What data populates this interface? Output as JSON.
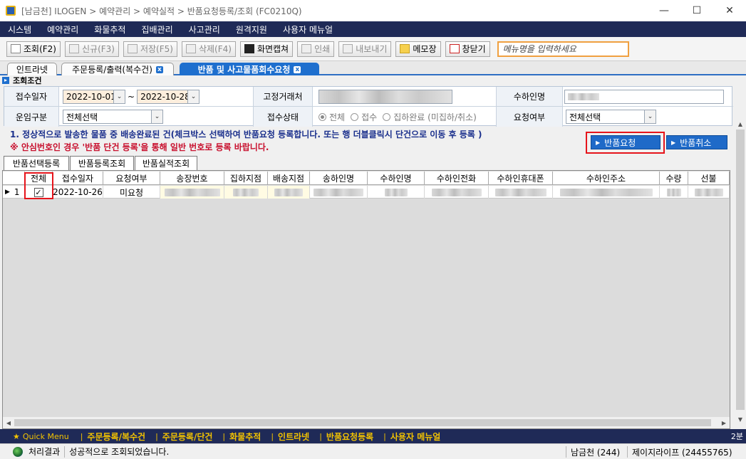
{
  "window": {
    "title": "[남금천] ILOGEN > 예약관리 > 예약실적 > 반품요청등록/조회 (FC0210Q)",
    "minimize_glyph": "—",
    "maximize_glyph": "☐",
    "close_glyph": "✕"
  },
  "menubar": [
    "시스템",
    "예약관리",
    "화물추적",
    "집배관리",
    "사고관리",
    "원격지원",
    "사용자 메뉴얼"
  ],
  "toolbar": {
    "buttons": [
      {
        "label": "조회(F2)",
        "icon": "search-doc-icon",
        "enabled": true
      },
      {
        "label": "신규(F3)",
        "icon": "new-doc-icon",
        "enabled": false
      },
      {
        "label": "저장(F5)",
        "icon": "save-icon",
        "enabled": false
      },
      {
        "label": "삭제(F4)",
        "icon": "delete-icon",
        "enabled": false
      },
      {
        "label": "화면캡쳐",
        "icon": "camera-icon",
        "enabled": true
      },
      {
        "label": "인쇄",
        "icon": "print-icon",
        "enabled": false
      },
      {
        "label": "내보내기",
        "icon": "export-icon",
        "enabled": false
      },
      {
        "label": "메모장",
        "icon": "memo-icon",
        "enabled": true
      },
      {
        "label": "창닫기",
        "icon": "close-window-icon",
        "enabled": true
      }
    ],
    "menu_search_placeholder": "메뉴명을 입력하세요"
  },
  "doc_tabs": [
    {
      "label": "인트라넷",
      "active": false,
      "closable": false
    },
    {
      "label": "주문등록/출력(복수건)",
      "active": false,
      "closable": true
    },
    {
      "label": "반품 및 사고물품회수요청",
      "active": true,
      "closable": true
    }
  ],
  "conditions": {
    "header": "조회조건",
    "receipt_date_label": "접수일자",
    "date_from": "2022-10-01",
    "date_tilde": "~",
    "date_to": "2022-10-28",
    "fixed_client_label": "고정거래처",
    "receiver_name_label": "수하인명",
    "fare_type_label": "운임구분",
    "fare_type_value": "전체선택",
    "receipt_status_label": "접수상태",
    "receipt_status_options": [
      "전체",
      "접수",
      "집하완료 (미집하/취소)"
    ],
    "receipt_status_selected": "전체",
    "request_label": "요청여부",
    "request_value": "전체선택",
    "dropdown_glyph": "⌄"
  },
  "notices": {
    "line1": "1. 정상적으로 발송한 물품 중 배송완료된 건(체크박스 선택하여 반품요청 등록합니다. 또는 행 더블클릭시 단건으로 이동 후 등록 )",
    "line2": "※ 안심번호인 경우 '반품 단건 등록'을 통해 일반 번호로 등록 바랍니다."
  },
  "actions": {
    "return_request": "반품요청",
    "return_cancel": "반품취소",
    "arrow_glyph": "▶"
  },
  "sub_tabs": [
    "반품선택등록",
    "반품등록조회",
    "반품실적조회"
  ],
  "grid": {
    "columns": [
      "전체",
      "접수일자",
      "요청여부",
      "송장번호",
      "집하지점",
      "배송지점",
      "송하인명",
      "수하인명",
      "수하인전화",
      "수하인휴대폰",
      "수하인주소",
      "수량",
      "선불"
    ],
    "rows": [
      {
        "indicator": "▶",
        "no": "1",
        "checked": true,
        "check_glyph": "✓",
        "receipt_date": "2022-10-26",
        "request_status": "미요청"
      }
    ]
  },
  "scrollbars": {
    "up": "▲",
    "down": "▼",
    "left": "◀",
    "right": "▶"
  },
  "quickbar": {
    "label": "Quick Menu",
    "star_glyph": "★",
    "separator": "|",
    "links": [
      "주문등록/복수건",
      "주문등록/단건",
      "화물추적",
      "인트라넷",
      "반품요청등록",
      "사용자 메뉴얼"
    ],
    "time": "2분"
  },
  "status": {
    "label": "처리결과",
    "message": "성공적으로 조회되었습니다.",
    "branch": "남금천 (244)",
    "user": "제이지라이프 (24455765)"
  },
  "colors": {
    "menubar": "#1f2a57",
    "accent": "#1e6fce",
    "highlight": "#e6141b",
    "notice_red": "#c8102e",
    "notice_blue": "#1a2f8c",
    "quick_yellow": "#f3c300"
  }
}
